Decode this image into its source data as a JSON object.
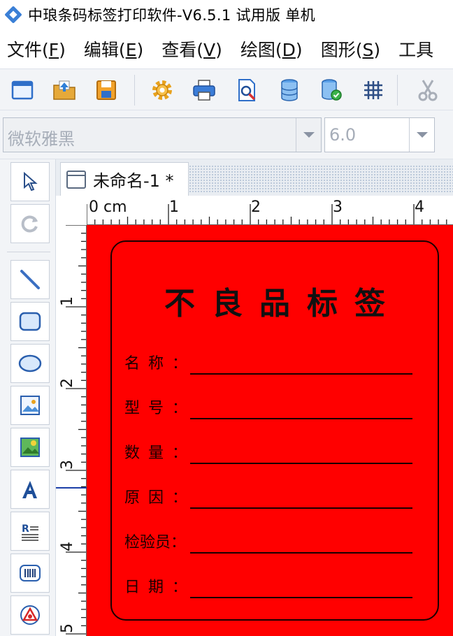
{
  "window": {
    "title": "中琅条码标签打印软件-V6.5.1 试用版 单机"
  },
  "menu": {
    "items": [
      {
        "label": "文件(",
        "accel": "F",
        "end": ")"
      },
      {
        "label": "编辑(",
        "accel": "E",
        "end": ")"
      },
      {
        "label": "查看(",
        "accel": "V",
        "end": ")"
      },
      {
        "label": "绘图(",
        "accel": "D",
        "end": ")"
      },
      {
        "label": "图形(",
        "accel": "S",
        "end": ")"
      },
      {
        "label": "工具",
        "accel": "",
        "end": ""
      }
    ]
  },
  "toolbar": {
    "buttons": [
      "new-document-icon",
      "open-folder-icon",
      "save-icon",
      "settings-gear-icon",
      "print-icon",
      "print-preview-icon",
      "database-icon",
      "database-connect-icon",
      "grid-icon",
      "cut-icon"
    ]
  },
  "fontbar": {
    "font_family": "微软雅黑",
    "font_size": "6.0"
  },
  "tools": {
    "items": [
      "select-arrow-icon",
      "rotate-icon",
      "line-icon",
      "rectangle-icon",
      "ellipse-icon",
      "image-icon",
      "image-color-icon",
      "text-icon",
      "rich-text-icon",
      "barcode-icon",
      "shape-icon"
    ]
  },
  "document": {
    "tab_title": "未命名-1 *"
  },
  "ruler": {
    "unit": "cm",
    "top_labels": [
      "0 cm",
      "1",
      "2",
      "3",
      "4"
    ],
    "left_labels": [
      "1",
      "2",
      "3",
      "4",
      "5"
    ]
  },
  "label": {
    "background_color": "#ff0000",
    "title": "不良品标签",
    "fields": [
      {
        "label": "名称："
      },
      {
        "label": "型号："
      },
      {
        "label": "数量："
      },
      {
        "label": "原因："
      },
      {
        "label": "检验员："
      },
      {
        "label": "日期："
      }
    ]
  }
}
